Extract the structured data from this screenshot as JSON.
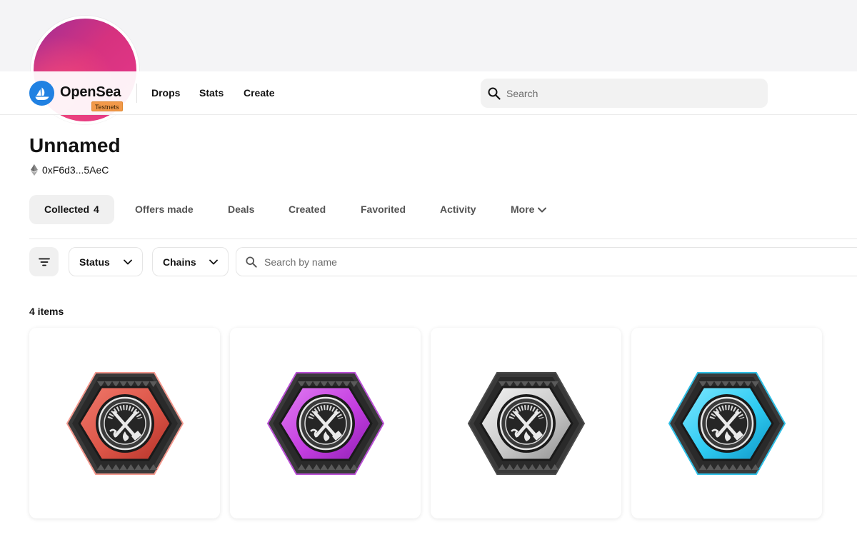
{
  "profile": {
    "name": "Unnamed",
    "address": "0xF6d3...5AeC",
    "chain_icon": "ethereum-icon"
  },
  "nav": {
    "brand": "OpenSea",
    "badge": "Testnets",
    "links": [
      "Drops",
      "Stats",
      "Create"
    ],
    "search_placeholder": "Search"
  },
  "tabs": [
    {
      "label": "Collected",
      "count": "4",
      "active": true
    },
    {
      "label": "Offers made"
    },
    {
      "label": "Deals"
    },
    {
      "label": "Created"
    },
    {
      "label": "Favorited"
    },
    {
      "label": "Activity"
    },
    {
      "label": "More"
    }
  ],
  "filters": {
    "filter_icon": "filter-lines-icon",
    "status_label": "Status",
    "chains_label": "Chains",
    "search_placeholder": "Search by name"
  },
  "items": {
    "count_label": "4 items",
    "cards": [
      {
        "variant": "red",
        "colors": {
          "light": "#f0786a",
          "mid": "#dc5548",
          "dark": "#b43228",
          "border": "#f2978c"
        }
      },
      {
        "variant": "purple",
        "colors": {
          "light": "#e07cf2",
          "mid": "#c43ee0",
          "dark": "#8f1fb4",
          "border": "#b84ed4"
        }
      },
      {
        "variant": "silver",
        "colors": {
          "light": "#f4f4f4",
          "mid": "#c9c9c9",
          "dark": "#8e8e8e",
          "border": "#4a4a4a"
        }
      },
      {
        "variant": "cyan",
        "colors": {
          "light": "#7ee8ff",
          "mid": "#2fcbf2",
          "dark": "#0e96c6",
          "border": "#2dbfe6"
        }
      }
    ]
  },
  "colors": {
    "accent": "#2081e2",
    "badge": "#f2994a",
    "avatar_start": "#a22f95",
    "avatar_end": "#e8388a"
  }
}
